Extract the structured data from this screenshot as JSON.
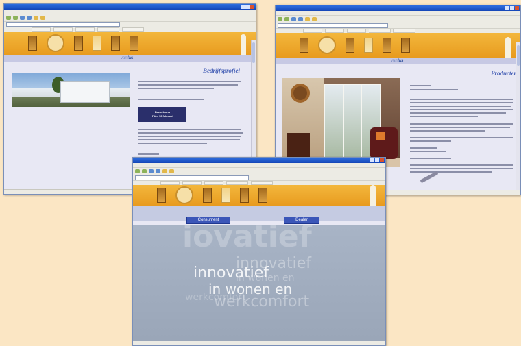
{
  "windows": {
    "profile": {
      "heading": "Bedrijfsprofiel",
      "logo_prefix": "van",
      "logo_main": "fas",
      "button_line1": "Bezoek ons",
      "button_line2": "7 t/m 10 februari"
    },
    "products": {
      "heading": "Producten",
      "logo_prefix": "van",
      "logo_main": "fas"
    },
    "intro": {
      "consumer_label": "Consument",
      "dealer_label": "Dealer",
      "ghost_words": [
        "iovatief",
        "innovatief",
        "in wonen en",
        "werkcomfort"
      ]
    }
  },
  "icons": {
    "close": "close-icon",
    "back": "back-arrow-icon",
    "forward": "forward-arrow-icon"
  },
  "colors": {
    "banner": "#f0a92e",
    "heading": "#4b64b8",
    "nav_button": "#3b56b8"
  }
}
